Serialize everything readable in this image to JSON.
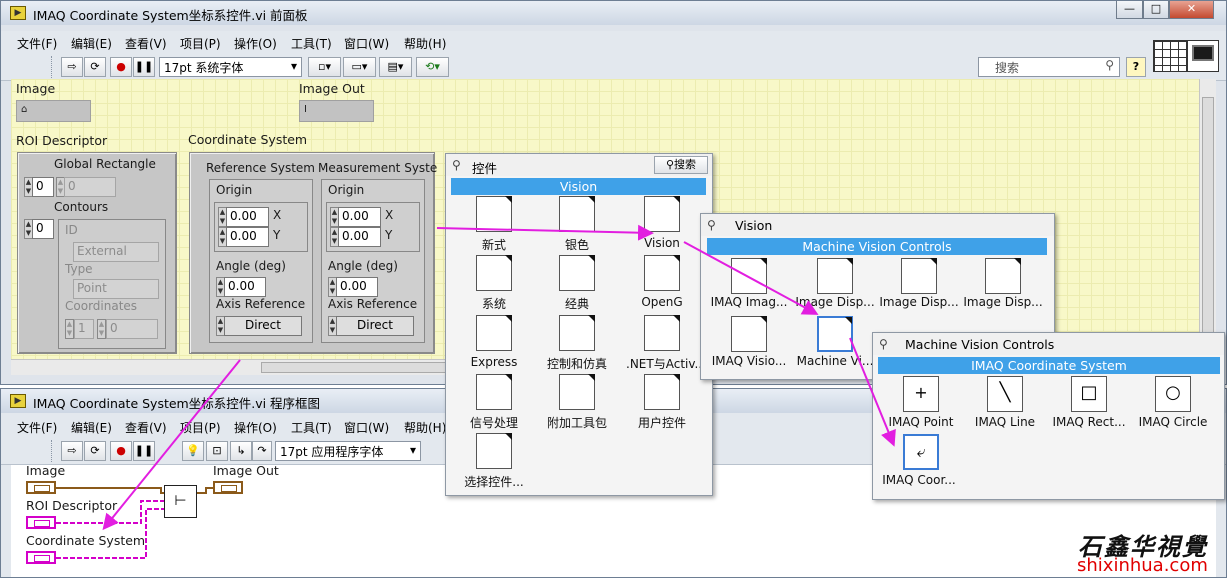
{
  "front_panel": {
    "title": "IMAQ Coordinate System坐标系控件.vi 前面板",
    "window_buttons": [
      "—",
      "□",
      "✕"
    ],
    "menu": [
      "文件(F)",
      "编辑(E)",
      "查看(V)",
      "项目(P)",
      "操作(O)",
      "工具(T)",
      "窗口(W)",
      "帮助(H)"
    ],
    "font_select": "17pt 系统字体",
    "search_placeholder": "搜索",
    "help_button": "?",
    "controls": {
      "image_label": "Image",
      "image_out_label": "Image Out",
      "roi_label": "ROI Descriptor",
      "global_rect_label": "Global Rectangle",
      "roi_index": "0",
      "global_value": "0",
      "contours_label": "Contours",
      "contours_index": "0",
      "id_label": "ID",
      "id_value": "External",
      "type_label": "Type",
      "type_value": "Point",
      "coordinates_label": "Coordinates",
      "coord_index": "1",
      "coord_value": "0",
      "coord_system_label": "Coordinate System",
      "ref_system_label": "Reference System",
      "meas_system_label": "Measurement Syste",
      "origin_label": "Origin",
      "x_value": "0.00",
      "y_value": "0.00",
      "x_label": "X",
      "y_label": "Y",
      "angle_label": "Angle (deg)",
      "angle_value": "0.00",
      "axis_ref_label": "Axis Reference",
      "axis_ref_value": "Direct"
    }
  },
  "block_diagram": {
    "title": "IMAQ Coordinate System坐标系控件.vi 程序框图",
    "menu": [
      "文件(F)",
      "编辑(E)",
      "查看(V)",
      "项目(P)",
      "操作(O)",
      "工具(T)",
      "窗口(W)",
      "帮助(H)"
    ],
    "font_select": "17pt 应用程序字体",
    "terminals": {
      "image": "Image",
      "image_out": "Image Out",
      "roi": "ROI Descriptor",
      "coord": "Coordinate System"
    }
  },
  "palette_controls": {
    "title": "控件",
    "search_button": "搜索",
    "band": "Vision",
    "items": [
      "新式",
      "银色",
      "Vision",
      "系统",
      "经典",
      "OpenG",
      "Express",
      "控制和仿真",
      ".NET与Activ...",
      "信号处理",
      "附加工具包",
      "用户控件",
      "选择控件..."
    ]
  },
  "palette_vision": {
    "title": "Vision",
    "band": "Machine Vision Controls",
    "items": [
      "IMAQ Imag...",
      "Image Disp...",
      "Image Disp...",
      "Image Disp...",
      "IMAQ Visio...",
      "Machine Vi..."
    ]
  },
  "palette_mvc": {
    "title": "Machine Vision Controls",
    "band": "IMAQ Coordinate System",
    "items": [
      "IMAQ Point",
      "IMAQ Line",
      "IMAQ Rect...",
      "IMAQ Circle",
      "IMAQ Coor..."
    ]
  },
  "watermark": {
    "chinese": "石鑫华視覺",
    "url": "shixinhua.com"
  },
  "colors": {
    "panel_yellow": "#f8f8c8",
    "palette_band": "#3fa1e8",
    "arrow_magenta": "#e21ee0",
    "wire_pink": "#d400c9"
  }
}
